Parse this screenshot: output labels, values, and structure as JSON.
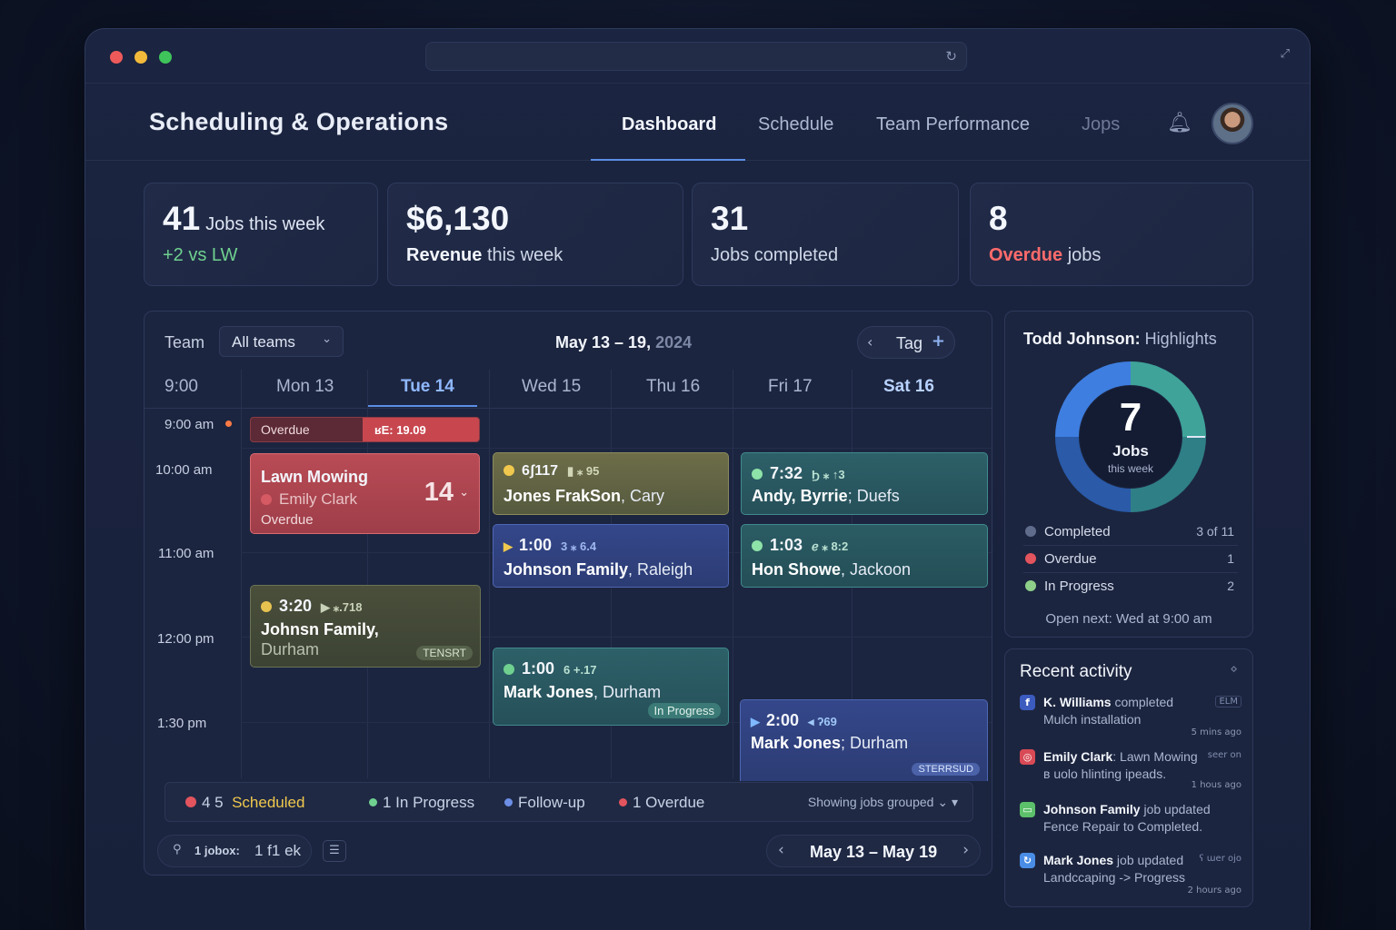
{
  "header": {
    "title": "Scheduling & Operations",
    "nav": [
      "Dashboard",
      "Schedule",
      "Team Performance",
      "Jops"
    ]
  },
  "stats": [
    {
      "value": "41",
      "label": "Jobs",
      "label_suffix": "this week",
      "sub": "+2 vs LW"
    },
    {
      "value": "$6,130",
      "sub_bold": "Revenue",
      "sub": "this week"
    },
    {
      "value": "31",
      "sub": "Jobs completed"
    },
    {
      "value": "8",
      "sub_bold": "Overdue",
      "sub": "jobs"
    }
  ],
  "calendar": {
    "team_label": "Team",
    "team_value": "All teams",
    "date_range": "May 13 – 19,",
    "year": "2024",
    "tag_label": "Tag",
    "time_header": "9:00",
    "days": [
      "Mon 13",
      "Tue 14",
      "Wed 15",
      "Thu 16",
      "Fri 17",
      "Sat 16"
    ],
    "times": [
      "9:00 am",
      "10:00 am",
      "11:00 am",
      "12:00 pm",
      "1:30 pm"
    ],
    "overdue_bar": {
      "label": "Overdue",
      "tag": "ʁE: 19.09"
    },
    "events": {
      "lawn": {
        "title": "Lawn Mowing",
        "person": "Emily Clark",
        "status": "Overdue",
        "num": "14"
      },
      "johnsn": {
        "time": "3:20",
        "meta": "▶ ⁎.718",
        "name": "Johnsn Family,",
        "city": "Durham",
        "pill": "TENSRT"
      },
      "jones_frak": {
        "time": "6ʃ117",
        "meta": "▮ ⁎ 95",
        "name": "Jones FrakSon",
        "city": ", Cary"
      },
      "johnson_raleigh": {
        "time": "1:00",
        "meta": "3 ⁎ 6.4",
        "name": "Johnson Family",
        "city": ", Raleigh"
      },
      "mark_wed": {
        "time": "1:00",
        "meta": "6 +.17",
        "name": "Mark Jones",
        "city": ", Durham",
        "pill": "In Progress"
      },
      "andy": {
        "time": "7:32",
        "meta": "Ϧ ⁎ ↑3",
        "name": "Andy, Byrrie",
        "city": "; Duefs"
      },
      "hon": {
        "time": "1:03",
        "meta": "ℯ ⁎ 8:2",
        "name": "Hon Showe",
        "city": ", Jackoon"
      },
      "mark_fri": {
        "time": "2:00",
        "meta": "◂ ʔ69",
        "name": "Mark Jones",
        "city": "; Durham",
        "pill": "STERRSUD"
      }
    },
    "legend": {
      "scheduled_count": "4 5",
      "scheduled": "Scheduled",
      "in_progress": "1 In Progress",
      "followup": "Follow-up",
      "overdue": "1 Overdue",
      "showing": "Showing  jobs grouped"
    },
    "footer": {
      "key": "1 jobox:",
      "val": "1 f1 ek",
      "range": "May 13 – May 19"
    }
  },
  "highlights": {
    "name": "Todd Johnson:",
    "suffix": "Highlights",
    "center_value": "7",
    "center_label": "Jobs",
    "center_sub": "this week",
    "rows": [
      {
        "name": "Completed",
        "value": "3 of 11"
      },
      {
        "name": "Overdue",
        "value": "1"
      },
      {
        "name": "In Progress",
        "value": "2"
      }
    ],
    "next": "Open next: Wed at 9:00 am"
  },
  "activity": {
    "title": "Recent activity",
    "items": [
      {
        "who": "K. Williams",
        "what": " completed",
        "line2": "Mulch installation",
        "tag": "ELM",
        "time": "5 mins ago"
      },
      {
        "who": "Emily Clark",
        "what": ": Lawn Mowing",
        "line2": "ʙ uolo hlinting ipeads.",
        "tag": "seer on",
        "time": "1 hous ago"
      },
      {
        "who": "Johnson Family",
        "what": " job updated",
        "line2": "Fence Repair to Completed.",
        "tag": "",
        "time": ""
      },
      {
        "who": "Mark Jones",
        "what": " job updated",
        "line2": "Landccaping -> Progress",
        "tag": "ʕ ɯer ojo",
        "time": "2 hours ago"
      }
    ]
  },
  "colors": {
    "accent": "#5b8de6",
    "overdue": "#e2545e",
    "completed": "#3f8a8d",
    "in_progress": "#6fd08f"
  }
}
